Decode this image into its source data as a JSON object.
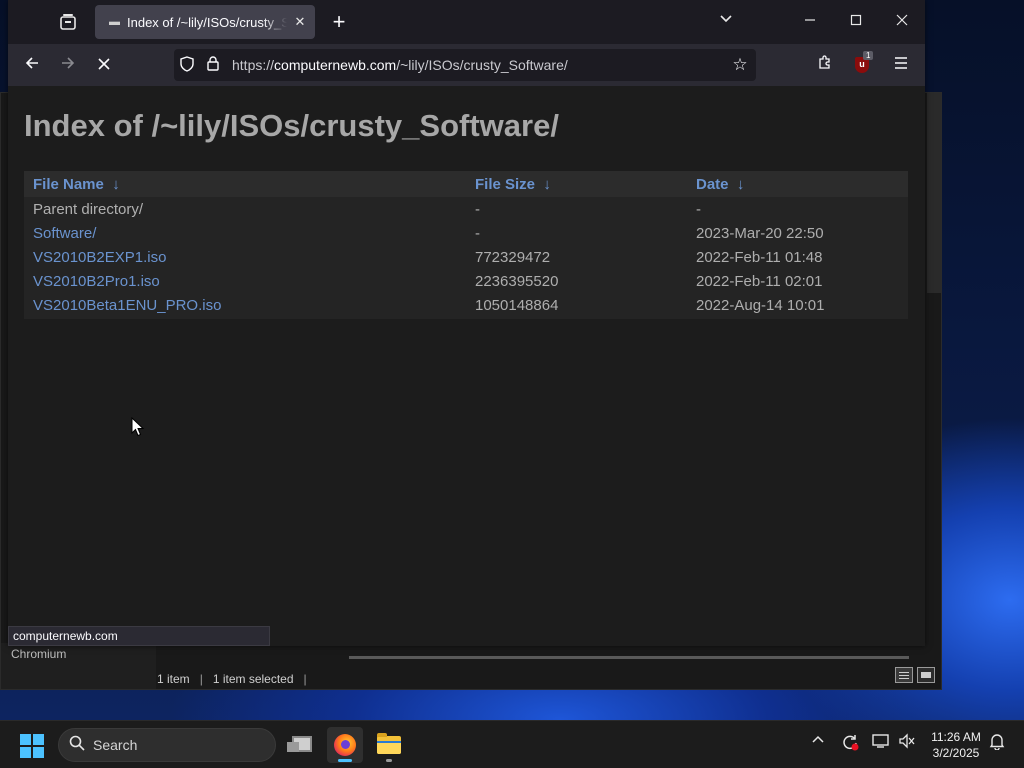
{
  "browser": {
    "tab": {
      "title": "Index of /~lily/ISOs/crusty_Software/"
    },
    "url": {
      "scheme_prefix": "https://",
      "domain": "computernewb.com",
      "path": "/~lily/ISOs/crusty_Software/"
    },
    "status_link": "computernewb.com",
    "extension_badge": "1"
  },
  "page": {
    "heading": "Index of /~lily/ISOs/crusty_Software/",
    "columns": [
      {
        "label": "File Name",
        "sort": "↓"
      },
      {
        "label": "File Size",
        "sort": "↓"
      },
      {
        "label": "Date",
        "sort": "↓"
      }
    ],
    "rows": [
      {
        "name": "Parent directory/",
        "size": "-",
        "date": "-"
      },
      {
        "name": "Software/",
        "size": "-",
        "date": "2023-Mar-20 22:50"
      },
      {
        "name": "VS2010B2EXP1.iso",
        "size": "772329472",
        "date": "2022-Feb-11 01:48"
      },
      {
        "name": "VS2010B2Pro1.iso",
        "size": "2236395520",
        "date": "2022-Feb-11 02:01"
      },
      {
        "name": "VS2010Beta1ENU_PRO.iso",
        "size": "1050148864",
        "date": "2022-Aug-14 10:01"
      }
    ]
  },
  "explorer": {
    "left_label": "Chromium",
    "item_count": "1 item",
    "selected": "1 item selected",
    "separator": "|"
  },
  "taskbar": {
    "search_label": "Search",
    "time": "11:26 AM",
    "date": "3/2/2025"
  },
  "colors": {
    "link": "#6a93cf",
    "page_bg": "#1c1c1c",
    "accent": "#4cc2ff"
  }
}
